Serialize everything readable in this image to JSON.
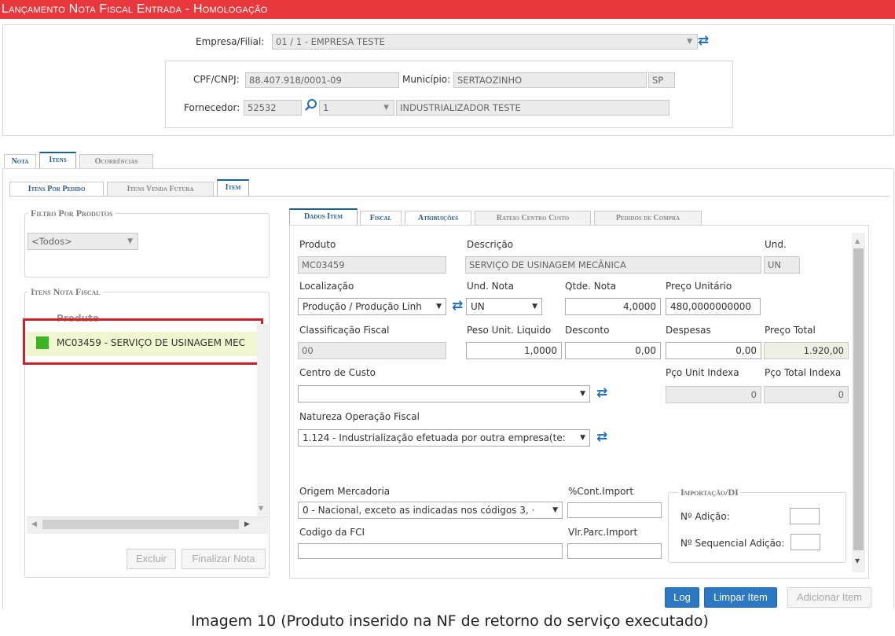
{
  "window": {
    "title": "Lançamento Nota Fiscal Entrada  - Homologação"
  },
  "header": {
    "empresa_label": "Empresa/Filial:",
    "empresa_value": "01 / 1 - EMPRESA TESTE",
    "cpf_label": "CPF/CNPJ:",
    "cpf_value": "88.407.918/0001-09",
    "municipio_label": "Município:",
    "municipio_value": "SERTAOZINHO",
    "uf_value": "SP",
    "fornecedor_label": "Fornecedor:",
    "fornecedor_code": "52532",
    "fornecedor_seq": "1",
    "fornecedor_name": "INDUSTRIALIZADOR TESTE"
  },
  "main_tabs": [
    "Nota",
    "Itens",
    "Ocorrências"
  ],
  "sub_tabs": [
    "Itens Por Pedido",
    "Itens Venda Futura",
    "Item"
  ],
  "left": {
    "filtro_legend": "Filtro Por Produtos",
    "filtro_value": "<Todos>",
    "itens_legend": "Itens Nota Fiscal",
    "col_header": "Produto",
    "items": [
      {
        "label": "MC03459 - SERVIÇO DE USINAGEM MEC",
        "status_color": "#3cb521"
      }
    ],
    "excluir_label": "Excluir",
    "finalizar_label": "Finalizar Nota"
  },
  "detail_tabs": [
    "Dados Item",
    "Fiscal",
    "Atribuições",
    "Rateio Centro Custo",
    "Pedidos de Compra"
  ],
  "form": {
    "produto_label": "Produto",
    "produto_value": "MC03459",
    "descricao_label": "Descrição",
    "descricao_value": "SERVIÇO DE USINAGEM MECÂNICA",
    "und_label": "Und.",
    "und_value": "UN",
    "localizacao_label": "Localização",
    "localizacao_value": "Produção / Produção Linh",
    "und_nota_label": "Und. Nota",
    "und_nota_value": "UN",
    "qtde_label": "Qtde. Nota",
    "qtde_value": "4,0000",
    "preco_unit_label": "Preço Unitário",
    "preco_unit_value": "480,0000000000",
    "class_fiscal_label": "Classificação Fiscal",
    "class_fiscal_value": "00",
    "peso_label": "Peso Unit. Liquido",
    "peso_value": "1,0000",
    "desconto_label": "Desconto",
    "desconto_value": "0,00",
    "despesas_label": "Despesas",
    "despesas_value": "0,00",
    "preco_total_label": "Preço Total",
    "preco_total_value": "1.920,00",
    "centro_custo_label": "Centro de Custo",
    "centro_custo_value": "",
    "pco_unit_idx_label": "Pço Unit Indexa",
    "pco_unit_idx_value": "0",
    "pco_total_idx_label": "Pço Total Indexa",
    "pco_total_idx_value": "0",
    "natureza_label": "Natureza Operação Fiscal",
    "natureza_value": "1.124 - Industrialização efetuada por outra empresa(te:",
    "origem_label": "Origem Mercadoria",
    "origem_value": "0 - Nacional, exceto as indicadas nos códigos 3, ·",
    "cont_import_label": "%Cont.Import",
    "cont_import_value": "",
    "codigo_fci_label": "Codigo da FCI",
    "codigo_fci_value": "",
    "vlr_parc_label": "Vlr.Parc.Import",
    "vlr_parc_value": "",
    "importacao_legend": "Importação/DI",
    "n_adicao_label": "Nº Adição:",
    "n_adicao_value": "",
    "n_seq_label": "Nº Sequencial Adição:",
    "n_seq_value": ""
  },
  "actions": {
    "log_label": "Log",
    "limpar_label": "Limpar Item",
    "adicionar_label": "Adicionar Item"
  },
  "caption": "Imagem 10 (Produto inserido na NF de retorno do serviço executado)",
  "colors": {
    "title_bar": "#e8383d",
    "accent": "#2d78c3",
    "highlight": "#d0202a",
    "selected_row": "#f0f6d0"
  }
}
